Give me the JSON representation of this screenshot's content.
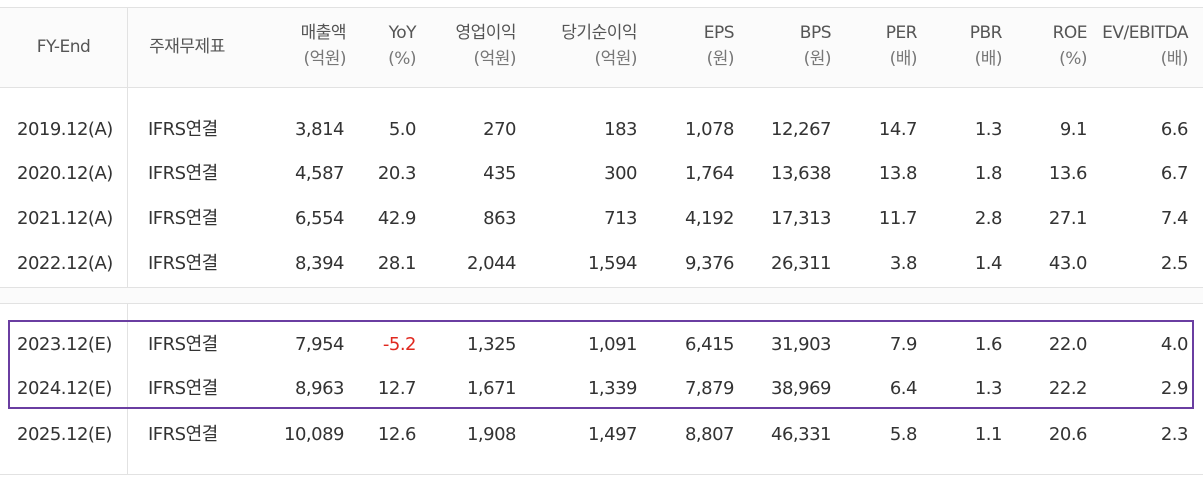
{
  "header": {
    "fy_end": "FY-End",
    "statement_type": "주재무제표",
    "revenue": {
      "label": "매출액",
      "unit": "(억원)"
    },
    "yoy": {
      "label": "YoY",
      "unit": "(%)"
    },
    "operating_income": {
      "label": "영업이익",
      "unit": "(억원)"
    },
    "net_income": {
      "label": "당기순이익",
      "unit": "(억원)"
    },
    "eps": {
      "label": "EPS",
      "unit": "(원)"
    },
    "bps": {
      "label": "BPS",
      "unit": "(원)"
    },
    "per": {
      "label": "PER",
      "unit": "(배)"
    },
    "pbr": {
      "label": "PBR",
      "unit": "(배)"
    },
    "roe": {
      "label": "ROE",
      "unit": "(%)"
    },
    "ev_ebitda": {
      "label": "EV/EBITDA",
      "unit": "(배)"
    }
  },
  "rows": [
    {
      "fy": "2019.12(A)",
      "type": "IFRS연결",
      "revenue": "3,814",
      "yoy": "5.0",
      "op": "270",
      "net": "183",
      "eps": "1,078",
      "bps": "12,267",
      "per": "14.7",
      "pbr": "1.3",
      "roe": "9.1",
      "ev": "6.6"
    },
    {
      "fy": "2020.12(A)",
      "type": "IFRS연결",
      "revenue": "4,587",
      "yoy": "20.3",
      "op": "435",
      "net": "300",
      "eps": "1,764",
      "bps": "13,638",
      "per": "13.8",
      "pbr": "1.8",
      "roe": "13.6",
      "ev": "6.7"
    },
    {
      "fy": "2021.12(A)",
      "type": "IFRS연결",
      "revenue": "6,554",
      "yoy": "42.9",
      "op": "863",
      "net": "713",
      "eps": "4,192",
      "bps": "17,313",
      "per": "11.7",
      "pbr": "2.8",
      "roe": "27.1",
      "ev": "7.4"
    },
    {
      "fy": "2022.12(A)",
      "type": "IFRS연결",
      "revenue": "8,394",
      "yoy": "28.1",
      "op": "2,044",
      "net": "1,594",
      "eps": "9,376",
      "bps": "26,311",
      "per": "3.8",
      "pbr": "1.4",
      "roe": "43.0",
      "ev": "2.5"
    },
    {
      "fy": "2023.12(E)",
      "type": "IFRS연결",
      "revenue": "7,954",
      "yoy": "-5.2",
      "op": "1,325",
      "net": "1,091",
      "eps": "6,415",
      "bps": "31,903",
      "per": "7.9",
      "pbr": "1.6",
      "roe": "22.0",
      "ev": "4.0"
    },
    {
      "fy": "2024.12(E)",
      "type": "IFRS연결",
      "revenue": "8,963",
      "yoy": "12.7",
      "op": "1,671",
      "net": "1,339",
      "eps": "7,879",
      "bps": "38,969",
      "per": "6.4",
      "pbr": "1.3",
      "roe": "22.2",
      "ev": "2.9"
    },
    {
      "fy": "2025.12(E)",
      "type": "IFRS연결",
      "revenue": "10,089",
      "yoy": "12.6",
      "op": "1,908",
      "net": "1,497",
      "eps": "8,807",
      "bps": "46,331",
      "per": "5.8",
      "pbr": "1.1",
      "roe": "20.6",
      "ev": "2.3"
    }
  ],
  "colors": {
    "negative": "#e0281f",
    "highlight_border": "#6a3ea1",
    "grid": "#e2e2e2"
  }
}
